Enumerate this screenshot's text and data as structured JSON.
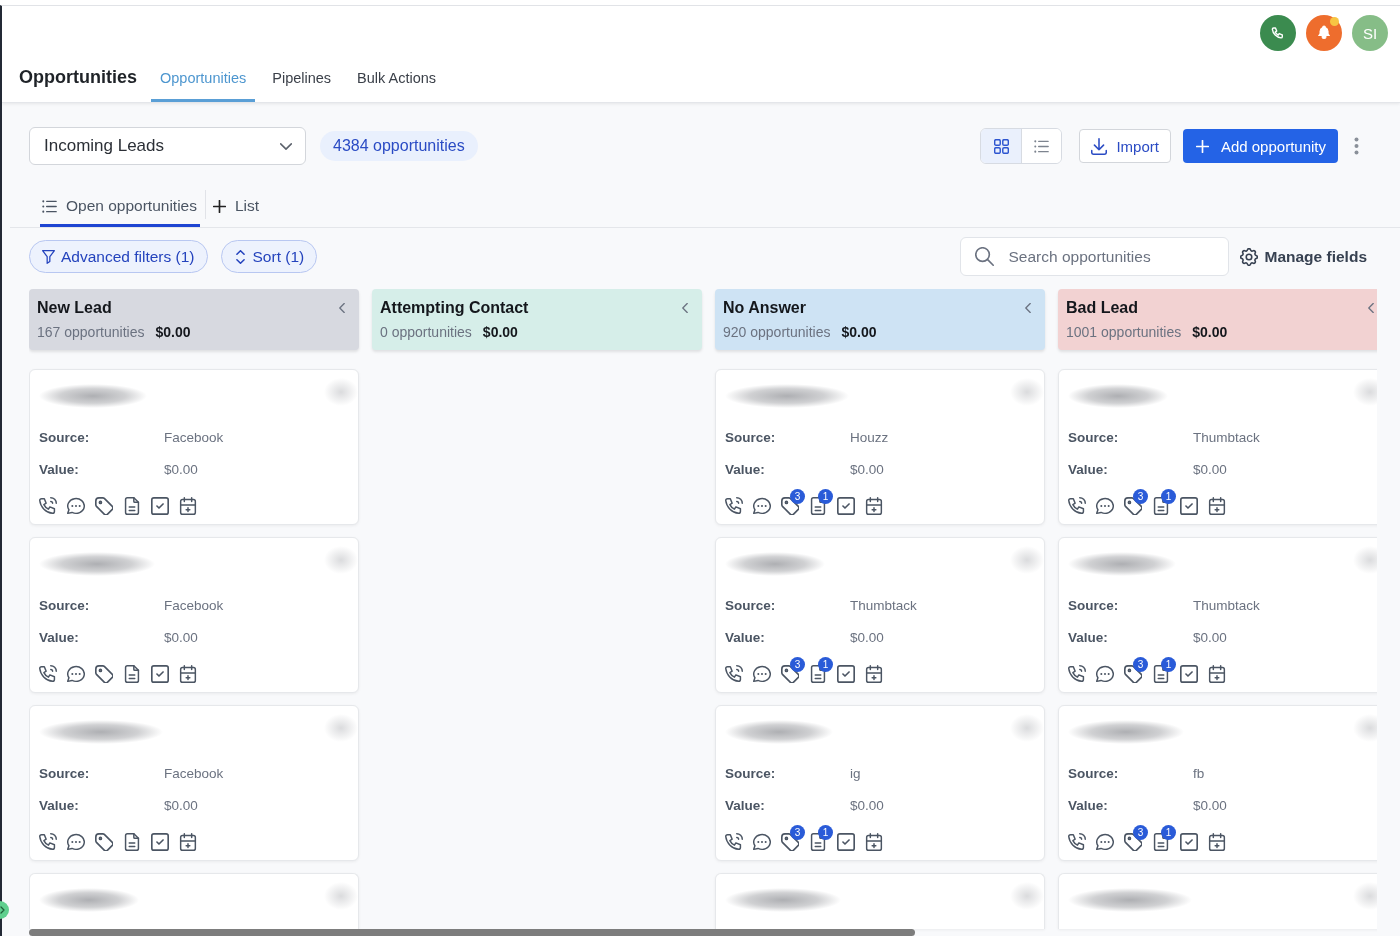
{
  "header": {
    "title": "Opportunities",
    "tabs": [
      {
        "label": "Opportunities",
        "selected": true
      },
      {
        "label": "Pipelines",
        "selected": false
      },
      {
        "label": "Bulk Actions",
        "selected": false
      }
    ],
    "notifications": {
      "unread": true
    },
    "avatar": {
      "initials": "SI"
    }
  },
  "toolbar": {
    "pipeline": "Incoming Leads",
    "count_badge": "4384 opportunities",
    "views": [
      {
        "kind": "board",
        "selected": true
      },
      {
        "kind": "list",
        "selected": false
      }
    ],
    "import_button": "Import",
    "add_button": "Add opportunity"
  },
  "view_tabs": [
    {
      "kind": "saved",
      "label": "Open opportunities",
      "selected": true
    },
    {
      "kind": "add",
      "label": "List",
      "selected": false
    }
  ],
  "filters": [
    {
      "kind": "filter",
      "label": "Advanced filters (1)"
    },
    {
      "kind": "sort",
      "label": "Sort (1)"
    }
  ],
  "search": {
    "placeholder": "Search opportunities"
  },
  "manage_fields": "Manage fields",
  "columns": [
    {
      "name": "New Lead",
      "count": "167 opportunities",
      "total": "$0.00",
      "color": "#d7d9e0",
      "cards": [
        {
          "kind": "full",
          "fields": [
            {
              "label": "Source:",
              "value": "Facebook"
            },
            {
              "label": "Value:",
              "value": "$0.00"
            }
          ]
        },
        {
          "kind": "full",
          "fields": [
            {
              "label": "Source:",
              "value": "Facebook"
            },
            {
              "label": "Value:",
              "value": "$0.00"
            }
          ]
        },
        {
          "kind": "full",
          "fields": [
            {
              "label": "Source:",
              "value": "Facebook"
            },
            {
              "label": "Value:",
              "value": "$0.00"
            }
          ]
        },
        {
          "kind": "clipped"
        }
      ]
    },
    {
      "name": "Attempting Contact",
      "count": "0 opportunities",
      "total": "$0.00",
      "color": "#d6eee9"
    },
    {
      "name": "No Answer",
      "count": "920 opportunities",
      "total": "$0.00",
      "color": "#cee3f4",
      "cards": [
        {
          "kind": "full",
          "fields": [
            {
              "label": "Source:",
              "value": "Houzz"
            },
            {
              "label": "Value:",
              "value": "$0.00"
            }
          ],
          "tag_badge": "3",
          "note_badge": "1"
        },
        {
          "kind": "full",
          "fields": [
            {
              "label": "Source:",
              "value": "Thumbtack"
            },
            {
              "label": "Value:",
              "value": "$0.00"
            }
          ],
          "tag_badge": "3",
          "note_badge": "1"
        },
        {
          "kind": "full",
          "fields": [
            {
              "label": "Source:",
              "value": "ig"
            },
            {
              "label": "Value:",
              "value": "$0.00"
            }
          ],
          "tag_badge": "3",
          "note_badge": "1"
        },
        {
          "kind": "clipped"
        }
      ]
    },
    {
      "name": "Bad Lead",
      "count": "1001 opportunities",
      "total": "$0.00",
      "color": "#f2d2d2",
      "cards": [
        {
          "kind": "full",
          "fields": [
            {
              "label": "Source:",
              "value": "Thumbtack"
            },
            {
              "label": "Value:",
              "value": "$0.00"
            }
          ],
          "tag_badge": "3",
          "note_badge": "1"
        },
        {
          "kind": "full",
          "fields": [
            {
              "label": "Source:",
              "value": "Thumbtack"
            },
            {
              "label": "Value:",
              "value": "$0.00"
            }
          ],
          "tag_badge": "3",
          "note_badge": "1"
        },
        {
          "kind": "full",
          "fields": [
            {
              "label": "Source:",
              "value": "fb"
            },
            {
              "label": "Value:",
              "value": "$0.00"
            }
          ],
          "tag_badge": "3",
          "note_badge": "1"
        },
        {
          "kind": "clipped"
        }
      ]
    }
  ]
}
